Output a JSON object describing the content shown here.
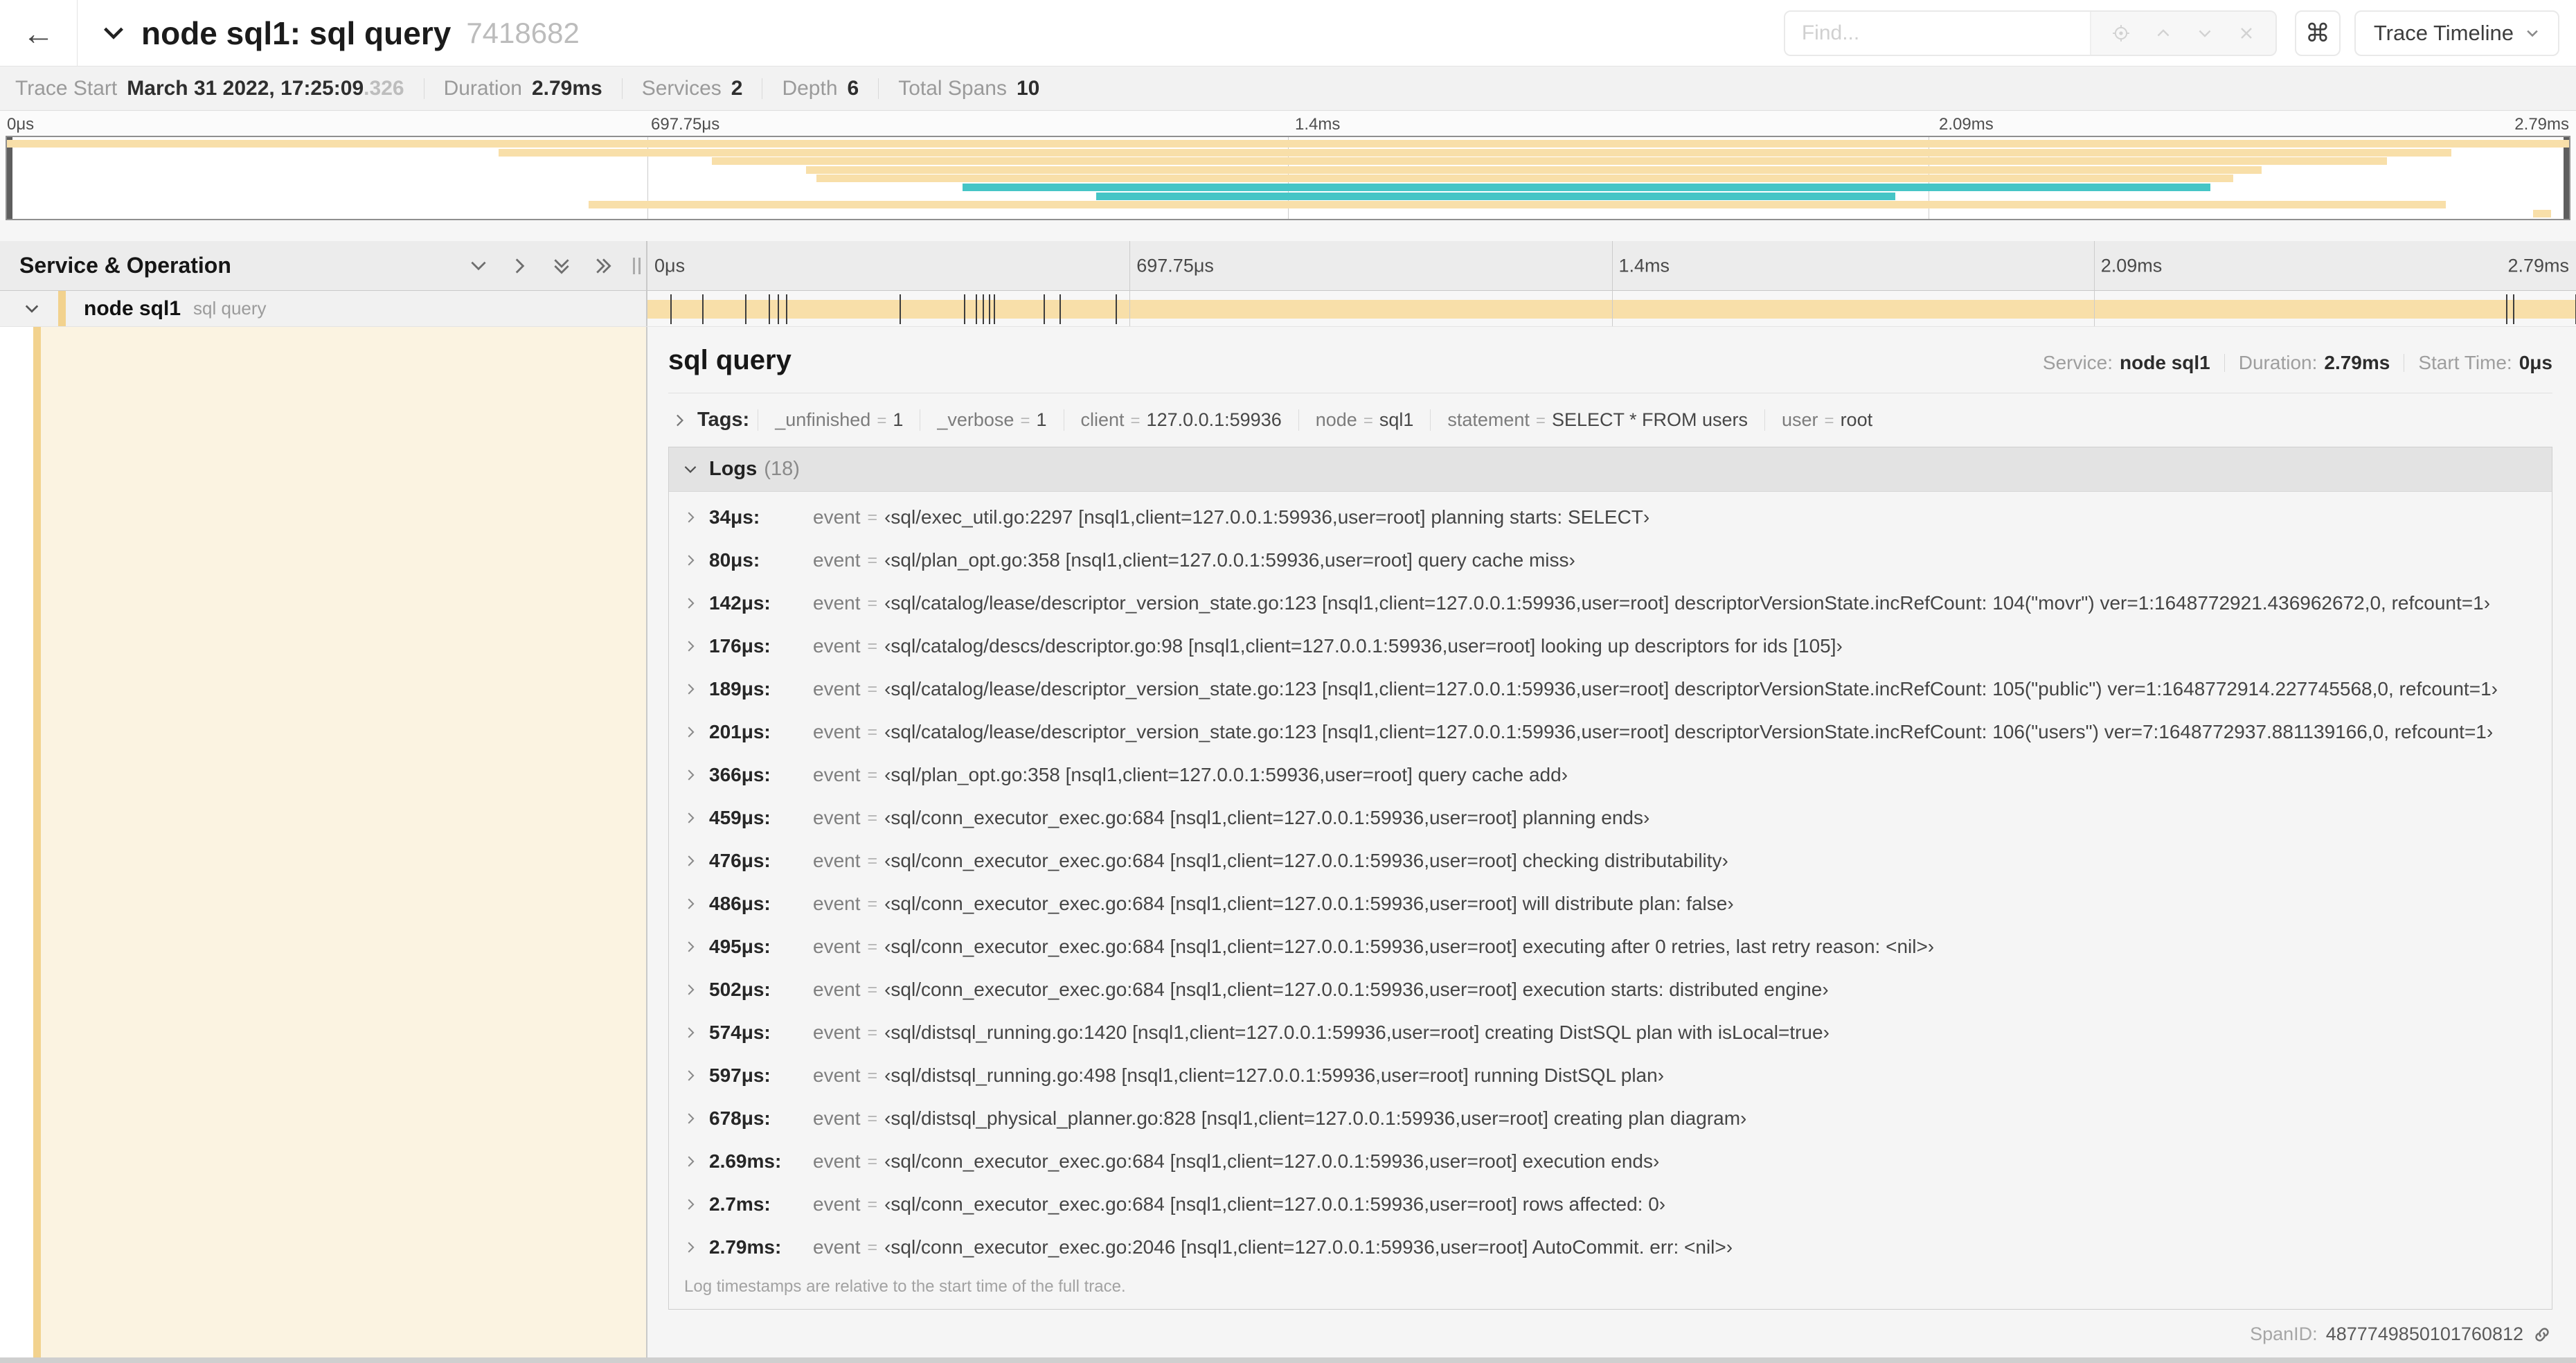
{
  "colors": {
    "beige": "#F8DFA9",
    "beige_accent": "#F2D28E",
    "cream": "#FBF3E1",
    "teal": "#45C5C6"
  },
  "header": {
    "back_icon": "←",
    "title": "node sql1: sql query",
    "trace_id": "7418682",
    "find_placeholder": "Find...",
    "shortcut_icon": "⌘",
    "view_selector_label": "Trace Timeline"
  },
  "trace_info": {
    "duration_us": 2790,
    "items": [
      {
        "label": "Trace Start",
        "value": "March 31 2022, 17:25:09",
        "suffix": ".326"
      },
      {
        "label": "Duration",
        "value": "2.79ms"
      },
      {
        "label": "Services",
        "value": "2"
      },
      {
        "label": "Depth",
        "value": "6"
      },
      {
        "label": "Total Spans",
        "value": "10"
      }
    ]
  },
  "ticks": [
    {
      "label": "0μs",
      "pct": 0
    },
    {
      "label": "697.75μs",
      "pct": 25
    },
    {
      "label": "1.4ms",
      "pct": 50
    },
    {
      "label": "2.09ms",
      "pct": 75
    },
    {
      "label": "2.79ms",
      "pct": 100
    }
  ],
  "minimap": {
    "spans": [
      {
        "start": 0,
        "end": 100,
        "color": "beige"
      },
      {
        "start": 19.2,
        "end": 95.4,
        "color": "beige"
      },
      {
        "start": 27.5,
        "end": 92.9,
        "color": "beige"
      },
      {
        "start": 31.2,
        "end": 88.0,
        "color": "beige"
      },
      {
        "start": 31.6,
        "end": 86.9,
        "color": "beige"
      },
      {
        "start": 37.3,
        "end": 86.0,
        "color": "teal"
      },
      {
        "start": 42.5,
        "end": 73.7,
        "color": "teal"
      },
      {
        "start": 22.7,
        "end": 95.2,
        "color": "beige"
      },
      {
        "start": 98.6,
        "end": 99.3,
        "color": "beige"
      }
    ]
  },
  "timeline": {
    "left_header": "Service & Operation",
    "row": {
      "service": "node sql1",
      "operation": "sql query"
    }
  },
  "detail": {
    "title": "sql query",
    "meta": [
      {
        "label": "Service:",
        "value": "node sql1"
      },
      {
        "label": "Duration:",
        "value": "2.79ms"
      },
      {
        "label": "Start Time:",
        "value": "0μs"
      }
    ],
    "tags_label": "Tags:",
    "kv_sep": "=",
    "tags": [
      {
        "key": "_unfinished",
        "value": "1"
      },
      {
        "key": "_verbose",
        "value": "1"
      },
      {
        "key": "client",
        "value": "127.0.0.1:59936"
      },
      {
        "key": "node",
        "value": "sql1"
      },
      {
        "key": "statement",
        "value": "SELECT * FROM users"
      },
      {
        "key": "user",
        "value": "root"
      }
    ],
    "logs_label": "Logs",
    "logs_count": "(18)",
    "logs": [
      {
        "time": "34μs:",
        "t_us": 34,
        "key": "event",
        "value": "‹sql/exec_util.go:2297 [nsql1,client=127.0.0.1:59936,user=root] planning starts: SELECT›"
      },
      {
        "time": "80μs:",
        "t_us": 80,
        "key": "event",
        "value": "‹sql/plan_opt.go:358 [nsql1,client=127.0.0.1:59936,user=root] query cache miss›"
      },
      {
        "time": "142μs:",
        "t_us": 142,
        "key": "event",
        "value": "‹sql/catalog/lease/descriptor_version_state.go:123 [nsql1,client=127.0.0.1:59936,user=root] descriptorVersionState.incRefCount: 104(\"movr\") ver=1:1648772921.436962672,0, refcount=1›"
      },
      {
        "time": "176μs:",
        "t_us": 176,
        "key": "event",
        "value": "‹sql/catalog/descs/descriptor.go:98 [nsql1,client=127.0.0.1:59936,user=root] looking up descriptors for ids [105]›"
      },
      {
        "time": "189μs:",
        "t_us": 189,
        "key": "event",
        "value": "‹sql/catalog/lease/descriptor_version_state.go:123 [nsql1,client=127.0.0.1:59936,user=root] descriptorVersionState.incRefCount: 105(\"public\") ver=1:1648772914.227745568,0, refcount=1›"
      },
      {
        "time": "201μs:",
        "t_us": 201,
        "key": "event",
        "value": "‹sql/catalog/lease/descriptor_version_state.go:123 [nsql1,client=127.0.0.1:59936,user=root] descriptorVersionState.incRefCount: 106(\"users\") ver=7:1648772937.881139166,0, refcount=1›"
      },
      {
        "time": "366μs:",
        "t_us": 366,
        "key": "event",
        "value": "‹sql/plan_opt.go:358 [nsql1,client=127.0.0.1:59936,user=root] query cache add›"
      },
      {
        "time": "459μs:",
        "t_us": 459,
        "key": "event",
        "value": "‹sql/conn_executor_exec.go:684 [nsql1,client=127.0.0.1:59936,user=root] planning ends›"
      },
      {
        "time": "476μs:",
        "t_us": 476,
        "key": "event",
        "value": "‹sql/conn_executor_exec.go:684 [nsql1,client=127.0.0.1:59936,user=root] checking distributability›"
      },
      {
        "time": "486μs:",
        "t_us": 486,
        "key": "event",
        "value": "‹sql/conn_executor_exec.go:684 [nsql1,client=127.0.0.1:59936,user=root] will distribute plan: false›"
      },
      {
        "time": "495μs:",
        "t_us": 495,
        "key": "event",
        "value": "‹sql/conn_executor_exec.go:684 [nsql1,client=127.0.0.1:59936,user=root] executing after 0 retries, last retry reason: <nil>›"
      },
      {
        "time": "502μs:",
        "t_us": 502,
        "key": "event",
        "value": "‹sql/conn_executor_exec.go:684 [nsql1,client=127.0.0.1:59936,user=root] execution starts: distributed engine›"
      },
      {
        "time": "574μs:",
        "t_us": 574,
        "key": "event",
        "value": "‹sql/distsql_running.go:1420 [nsql1,client=127.0.0.1:59936,user=root] creating DistSQL plan with isLocal=true›"
      },
      {
        "time": "597μs:",
        "t_us": 597,
        "key": "event",
        "value": "‹sql/distsql_running.go:498 [nsql1,client=127.0.0.1:59936,user=root] running DistSQL plan›"
      },
      {
        "time": "678μs:",
        "t_us": 678,
        "key": "event",
        "value": "‹sql/distsql_physical_planner.go:828 [nsql1,client=127.0.0.1:59936,user=root] creating plan diagram›"
      },
      {
        "time": "2.69ms:",
        "t_us": 2690,
        "key": "event",
        "value": "‹sql/conn_executor_exec.go:684 [nsql1,client=127.0.0.1:59936,user=root] execution ends›"
      },
      {
        "time": "2.7ms:",
        "t_us": 2700,
        "key": "event",
        "value": "‹sql/conn_executor_exec.go:684 [nsql1,client=127.0.0.1:59936,user=root] rows affected: 0›"
      },
      {
        "time": "2.79ms:",
        "t_us": 2790,
        "key": "event",
        "value": "‹sql/conn_executor_exec.go:2046 [nsql1,client=127.0.0.1:59936,user=root] AutoCommit. err: <nil>›"
      }
    ],
    "logs_footer": "Log timestamps are relative to the start time of the full trace.",
    "span_id_label": "SpanID:",
    "span_id": "4877749850101760812"
  }
}
